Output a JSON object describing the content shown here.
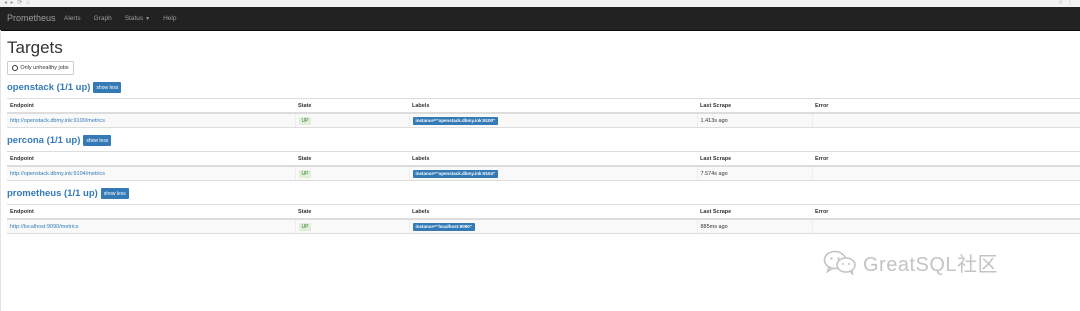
{
  "navbar": {
    "brand": "Prometheus",
    "items": [
      {
        "label": "Alerts"
      },
      {
        "label": "Graph"
      },
      {
        "label": "Status"
      },
      {
        "label": "Help"
      }
    ]
  },
  "page": {
    "title": "Targets",
    "filter_button": "Only unhealthy jobs"
  },
  "table_headers": [
    "Endpoint",
    "State",
    "Labels",
    "Last Scrape",
    "Error"
  ],
  "jobs": [
    {
      "title": "openstack (1/1 up)",
      "toggle": "show less",
      "rows": [
        {
          "endpoint": "http://openstack.dbmy.ink:9100/metrics",
          "state": "UP",
          "labels": "instance=\"openstack.dbmy.ink:9100\"",
          "last_scrape": "1.413s ago",
          "error": ""
        }
      ]
    },
    {
      "title": "percona (1/1 up)",
      "toggle": "show less",
      "rows": [
        {
          "endpoint": "http://openstack.dbmy.ink:9104/metrics",
          "state": "UP",
          "labels": "instance=\"openstack.dbmy.ink:9104\"",
          "last_scrape": "7.574s ago",
          "error": ""
        }
      ]
    },
    {
      "title": "prometheus (1/1 up)",
      "toggle": "show less",
      "rows": [
        {
          "endpoint": "http://localhost:9090/metrics",
          "state": "UP",
          "labels": "instance=\"localhost:9090\"",
          "last_scrape": "885ms ago",
          "error": ""
        }
      ]
    }
  ],
  "watermark": "GreatSQL社区",
  "colors": {
    "navbar": "#222222",
    "link": "#337ab7",
    "up_bg": "#dff0d8",
    "up_text": "#3c763d"
  }
}
